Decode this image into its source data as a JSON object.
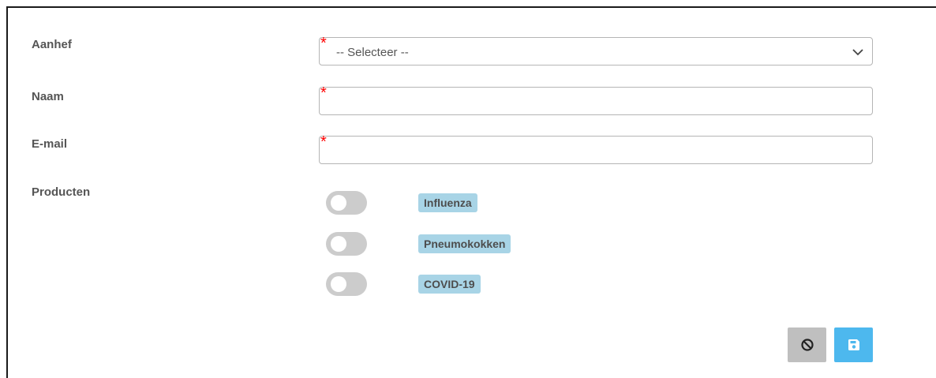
{
  "form": {
    "aanhef": {
      "label": "Aanhef",
      "value": "-- Selecteer --",
      "required_mark": "*"
    },
    "naam": {
      "label": "Naam",
      "value": "",
      "required_mark": "*"
    },
    "email": {
      "label": "E-mail",
      "value": "",
      "required_mark": "*"
    },
    "producten": {
      "label": "Producten",
      "items": [
        {
          "name": "Influenza",
          "enabled": false
        },
        {
          "name": "Pneumokokken",
          "enabled": false
        },
        {
          "name": "COVID-19",
          "enabled": false
        }
      ]
    }
  },
  "actions": {
    "cancel_icon": "ban-icon",
    "save_icon": "floppy-disk-icon"
  },
  "colors": {
    "required": "#ff0000",
    "tag_background": "#a8d4e6",
    "toggle_off": "#cccccc",
    "cancel_button": "#bfbfbf",
    "save_button": "#4db8ee"
  }
}
